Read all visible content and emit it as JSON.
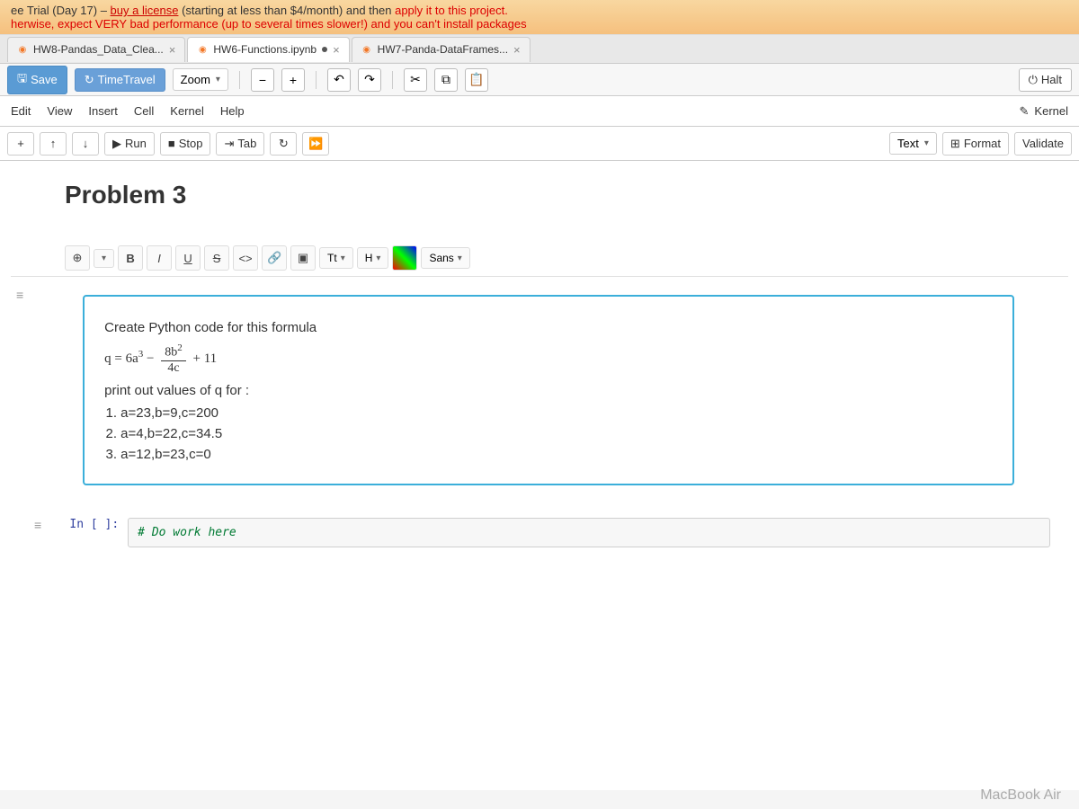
{
  "banner": {
    "line1_prefix": "ee Trial (Day 17) – ",
    "line1_link": "buy a license",
    "line1_mid": " (starting at less than $4/month) and then ",
    "line1_bold": "apply it to this project.",
    "line2_prefix": "herwise, expect VERY bad performance (up to several times slower!) and ",
    "line2_suffix": "you can't install packages"
  },
  "tabs": [
    {
      "label": "HW8-Pandas_Data_Clea...",
      "active": false
    },
    {
      "label": "HW6-Functions.ipynb",
      "active": true
    },
    {
      "label": "HW7-Panda-DataFrames...",
      "active": false
    }
  ],
  "toolbar1": {
    "save": "Save",
    "timetravel": "TimeTravel",
    "zoom": "Zoom",
    "halt": "Halt"
  },
  "menu": {
    "items": [
      "Edit",
      "View",
      "Insert",
      "Cell",
      "Kernel",
      "Help"
    ],
    "kernel": "Kernel"
  },
  "nb_toolbar": {
    "run": "Run",
    "stop": "Stop",
    "tab": "Tab",
    "text": "Text",
    "format": "Format",
    "validate": "Validate"
  },
  "problem3": {
    "title": "Problem 3"
  },
  "rte": {
    "h": "H",
    "tt": "Tt",
    "sans": "Sans"
  },
  "problem": {
    "line1": "Create Python code for this formula",
    "formula_q": "q = 6a",
    "formula_exp": "3",
    "formula_minus": " − ",
    "frac_num_a": "8b",
    "frac_num_exp": "2",
    "frac_den": "4c",
    "formula_plus": " + 11",
    "line2": "print out values of q for :",
    "items": [
      "a=23,b=9,c=200",
      "a=4,b=22,c=34.5",
      "a=12,b=23,c=0"
    ]
  },
  "code": {
    "prompt": "In [ ]:",
    "comment": "# Do work here"
  },
  "footer": "MacBook Air"
}
